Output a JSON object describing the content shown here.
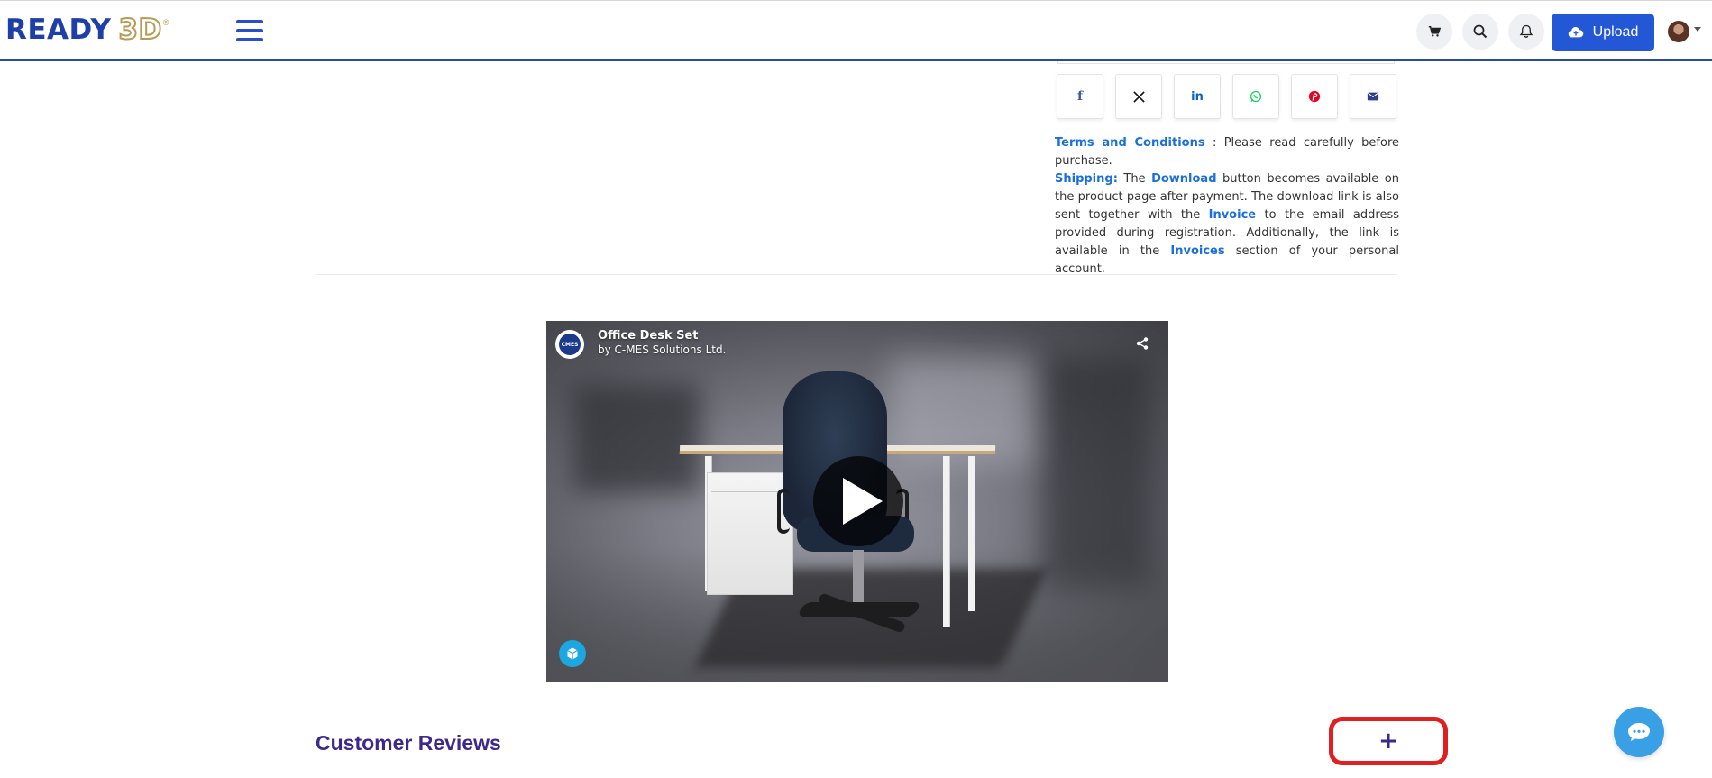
{
  "header": {
    "logo_main": "READY",
    "logo_accent": "3D",
    "logo_reg": "®",
    "upload_label": "Upload",
    "icons": [
      "cart-icon",
      "search-icon",
      "bell-icon",
      "cloud-upload-icon",
      "hamburger-icon"
    ],
    "accent_color": "#2457d6"
  },
  "share": {
    "buttons": [
      {
        "name": "facebook",
        "glyph": "f",
        "color": "#3b5998"
      },
      {
        "name": "x",
        "glyph": "𝕏",
        "color": "#111111"
      },
      {
        "name": "linkedin",
        "glyph": "in",
        "color": "#0a66c2"
      },
      {
        "name": "whatsapp",
        "glyph": "◎",
        "color": "#25d366"
      },
      {
        "name": "pinterest",
        "glyph": "P",
        "color": "#e60023"
      },
      {
        "name": "email",
        "glyph": "✉",
        "color": "#2b3f8a"
      }
    ]
  },
  "terms": {
    "title": "Terms and Conditions",
    "title_suffix": " : Please read carefully before purchase.",
    "shipping_label": "Shipping:",
    "text_1": " The ",
    "download": "Download",
    "text_2": " button becomes available on the product page after payment. The download link is also sent together with the ",
    "invoice": "Invoice",
    "text_3": " to the email address provided during registration. Additionally, the link is available in the ",
    "invoices": "Invoices",
    "text_4": " section of your personal account."
  },
  "video": {
    "title": "Office Desk Set",
    "by_prefix": "by ",
    "author": "C-MES Solutions Ltd.",
    "avatar_text": "CMES"
  },
  "reviews": {
    "title": "Customer Reviews",
    "add_label": "+"
  }
}
